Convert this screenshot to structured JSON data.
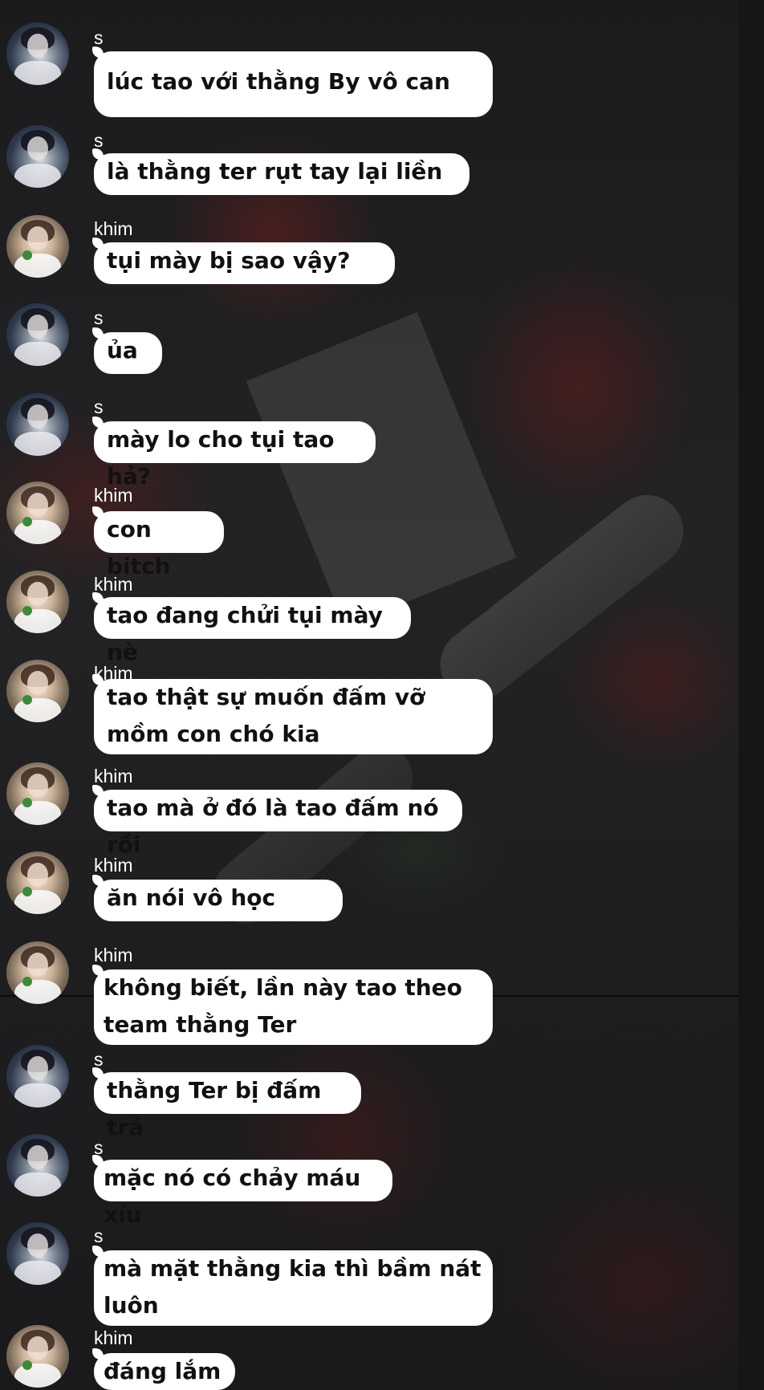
{
  "messages": [
    {
      "sender": "s",
      "text": "lúc tao với thằng By vô can"
    },
    {
      "sender": "s",
      "text": "là thằng ter rụt tay lại liền"
    },
    {
      "sender": "khim",
      "text": "tụi mày bị sao vậy?"
    },
    {
      "sender": "s",
      "text": "ủa"
    },
    {
      "sender": "s",
      "text": "mày lo cho tụi tao hả?"
    },
    {
      "sender": "khim",
      "text": "con bitch"
    },
    {
      "sender": "khim",
      "text": "tao đang chửi tụi mày nè"
    },
    {
      "sender": "khim",
      "text": "tao thật sự muốn đấm vỡ mồm con chó kia"
    },
    {
      "sender": "khim",
      "text": "tao mà ở đó là tao đấm nó rồi"
    },
    {
      "sender": "khim",
      "text": "ăn nói vô học"
    },
    {
      "sender": "khim",
      "text": "không biết, lần này tao theo team thằng Ter"
    },
    {
      "sender": "s",
      "text": "thằng Ter bị đấm trả"
    },
    {
      "sender": "s",
      "text": "mặc nó có chảy máu xíu"
    },
    {
      "sender": "s",
      "text": "mà mặt thằng kia thì bầm nát luôn"
    },
    {
      "sender": "khim",
      "text": "đáng lắm"
    }
  ]
}
